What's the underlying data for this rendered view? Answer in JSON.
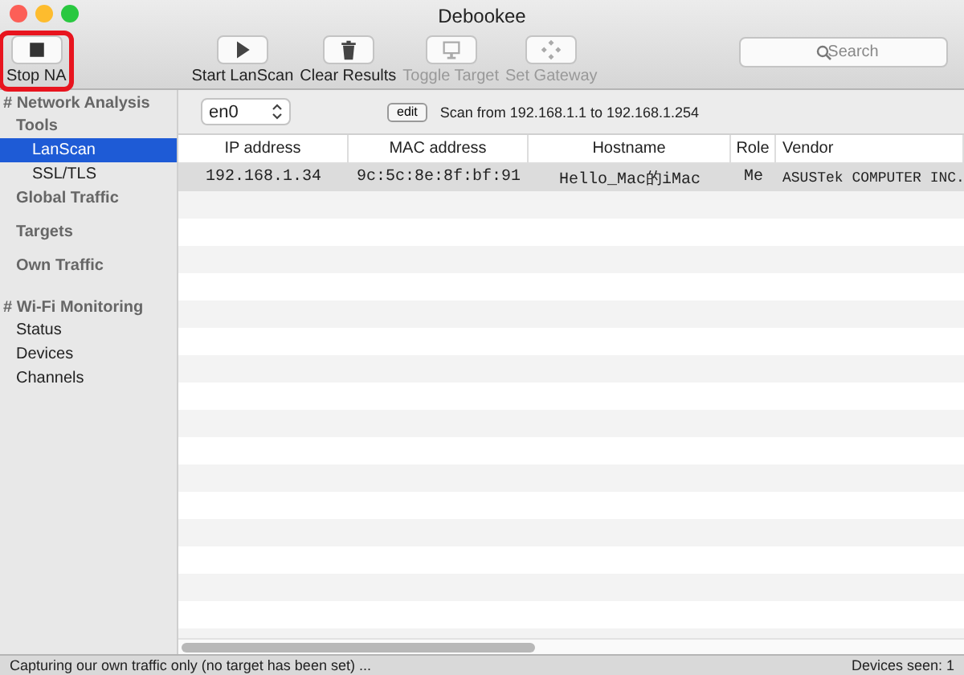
{
  "window": {
    "title": "Debookee"
  },
  "toolbar": [
    {
      "label": "Stop NA",
      "kind": "stop",
      "disabled": false,
      "highlighted": true
    },
    {
      "label": "Start LanScan",
      "kind": "play",
      "disabled": false,
      "highlighted": false
    },
    {
      "label": "Clear Results",
      "kind": "trash",
      "disabled": false,
      "highlighted": false
    },
    {
      "label": "Toggle Target",
      "kind": "monitor",
      "disabled": true,
      "highlighted": false
    },
    {
      "label": "Set Gateway",
      "kind": "gateway",
      "disabled": true,
      "highlighted": false
    }
  ],
  "search": {
    "placeholder": "Search"
  },
  "sidebar": {
    "sections": [
      {
        "title": "# Network Analysis",
        "items": [
          {
            "label": "Tools",
            "selected": false,
            "children": [
              {
                "label": "LanScan",
                "selected": true
              },
              {
                "label": "SSL/TLS",
                "selected": false
              }
            ]
          },
          {
            "label": "Global Traffic",
            "selected": false
          },
          {
            "label": "Targets",
            "selected": false
          },
          {
            "label": "Own Traffic",
            "selected": false
          }
        ]
      },
      {
        "title": "# Wi-Fi Monitoring",
        "items": [
          {
            "label": "Status",
            "selected": false
          },
          {
            "label": "Devices",
            "selected": false
          },
          {
            "label": "Channels",
            "selected": false
          }
        ]
      }
    ]
  },
  "scan_bar": {
    "interface": "en0",
    "edit_button": "edit",
    "range": "Scan from 192.168.1.1 to 192.168.1.254"
  },
  "table": {
    "columns": [
      "IP address",
      "MAC address",
      "Hostname",
      "Role",
      "Vendor"
    ],
    "rows": [
      {
        "cells": [
          "192.168.1.34",
          "9c:5c:8e:8f:bf:91",
          "Hello_Mac的iMac",
          "Me",
          "ASUSTek COMPUTER INC."
        ],
        "selected": true
      }
    ]
  },
  "status_bar": {
    "message": "Capturing our own traffic only (no target has been set) ...",
    "count": "Devices seen: 1"
  }
}
